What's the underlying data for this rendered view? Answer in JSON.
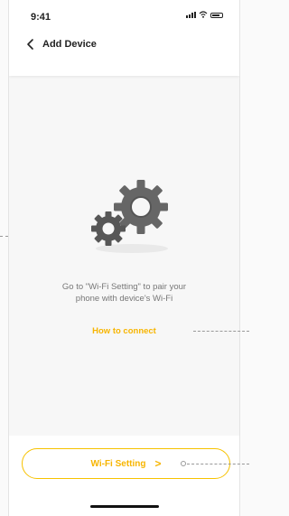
{
  "status_bar": {
    "time": "9:41"
  },
  "header": {
    "title": "Add Device"
  },
  "instructions": {
    "line1": "Go to \"Wi-Fi Setting\" to pair your",
    "line2": "phone with device's Wi-Fi"
  },
  "help_link": "How to connect",
  "primary_button": {
    "label": "Wi-Fi Setting"
  },
  "colors": {
    "accent": "#f7b500",
    "gear": "#6b6b6b",
    "background": "#f7f7f7"
  }
}
